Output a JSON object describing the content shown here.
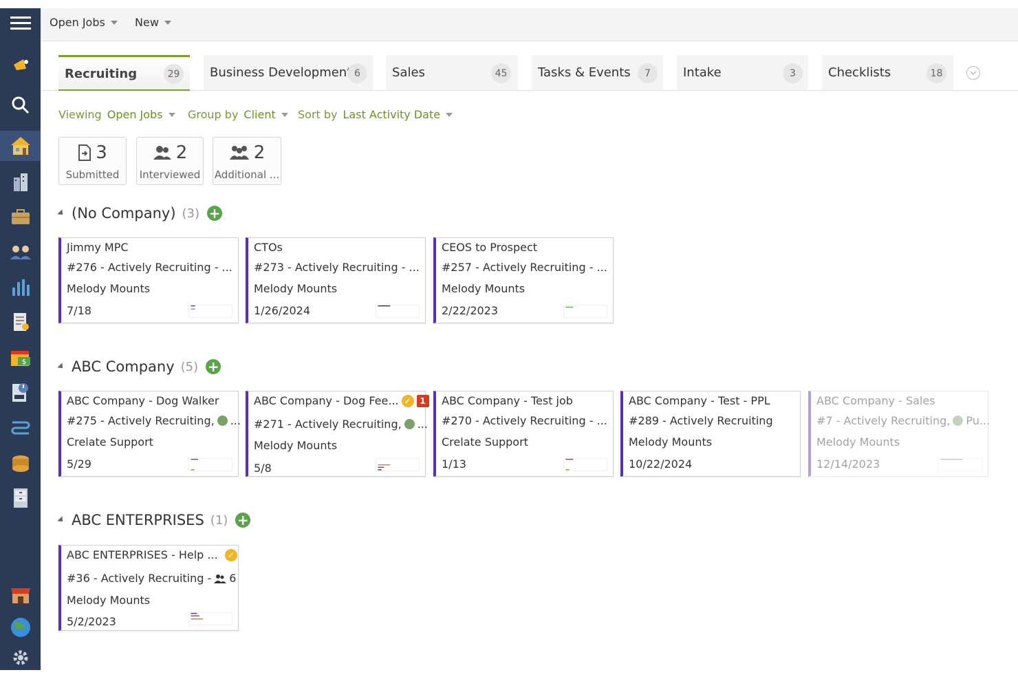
{
  "menubar": {
    "open_jobs": "Open Jobs",
    "new": "New"
  },
  "tabs": [
    {
      "label": "Recruiting",
      "count": "29"
    },
    {
      "label": "Business Development",
      "count": "6"
    },
    {
      "label": "Sales",
      "count": "45"
    },
    {
      "label": "Tasks & Events",
      "count": "7"
    },
    {
      "label": "Intake",
      "count": "3"
    },
    {
      "label": "Checklists",
      "count": "18"
    }
  ],
  "filters": {
    "viewing_label": "Viewing",
    "viewing_value": "Open Jobs",
    "group_label": "Group by",
    "group_value": "Client",
    "sort_label": "Sort by",
    "sort_value": "Last Activity Date"
  },
  "stats": [
    {
      "count": "3",
      "label": "Submitted",
      "icon": "document-arrow-icon"
    },
    {
      "count": "2",
      "label": "Interviewed",
      "icon": "people-icon"
    },
    {
      "count": "2",
      "label": "Additional ...",
      "icon": "group-icon"
    }
  ],
  "groups": [
    {
      "title": "(No Company)",
      "count": "(3)",
      "cards": [
        {
          "title": "Jimmy MPC",
          "status": "#276 - Actively Recruiting - ...",
          "owner": "Melody Mounts",
          "date": "7/18"
        },
        {
          "title": "CTOs",
          "status": "#273 - Actively Recruiting - ...",
          "owner": "Melody Mounts",
          "date": "1/26/2024"
        },
        {
          "title": "CEOS to Prospect",
          "status": "#257 - Actively Recruiting - ...",
          "owner": "Melody Mounts",
          "date": "2/22/2023"
        }
      ]
    },
    {
      "title": "ABC Company",
      "count": "(5)",
      "cards": [
        {
          "title": "ABC Company - Dog Walker",
          "status": "#275 - Actively Recruiting,",
          "status_tail": "...",
          "owner": "Crelate Support",
          "date": "5/29"
        },
        {
          "title": "ABC Company - Dog Fee...",
          "badge": "1",
          "status": "#271 - Actively Recruiting,",
          "status_tail": "...",
          "owner": "Melody Mounts",
          "date": "5/8"
        },
        {
          "title": "ABC Company - Test job",
          "status": "#270 - Actively Recruiting - ...",
          "owner": "Crelate Support",
          "date": "1/13"
        },
        {
          "title": "ABC Company - Test - PPL",
          "status": "#289 - Actively Recruiting",
          "owner": "Melody Mounts",
          "date": "10/22/2024"
        },
        {
          "title": "ABC Company - Sales",
          "status": "#7 - Actively Recruiting,",
          "status_tail": "Pu...",
          "owner": "Melody Mounts",
          "date": "12/14/2023"
        }
      ]
    },
    {
      "title": "ABC ENTERPRISES",
      "count": "(1)",
      "cards": [
        {
          "title": "ABC ENTERPRISES - Help ...",
          "status": "#36 - Actively Recruiting -",
          "status_count": "6",
          "owner": "Melody Mounts",
          "date": "5/2/2023"
        }
      ]
    }
  ],
  "colors": {
    "sidebar": "#2b3a55",
    "accent_green": "#7aa02a",
    "card_border": "#5b2fb8",
    "add_button": "#5aa34a"
  }
}
